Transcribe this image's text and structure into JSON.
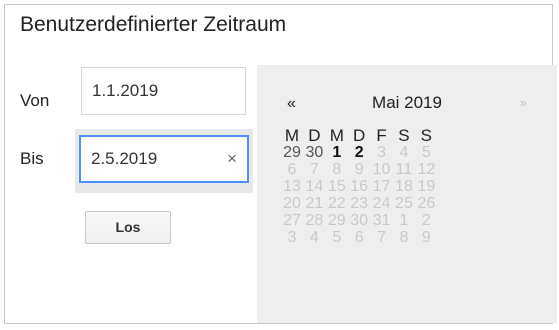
{
  "title": "Benutzerdefinierter Zeitraum",
  "from": {
    "label": "Von",
    "value": "1.1.2019"
  },
  "to": {
    "label": "Bis",
    "value": "2.5.2019",
    "clear_icon": "×"
  },
  "submit_label": "Los",
  "calendar": {
    "prev": "«",
    "next": "»",
    "month": "Mai 2019",
    "weekdays": [
      "M",
      "D",
      "M",
      "D",
      "F",
      "S",
      "S"
    ],
    "weeks": [
      [
        "29",
        "30",
        "1",
        "2",
        "3",
        "4",
        "5"
      ],
      [
        "6",
        "7",
        "8",
        "9",
        "10",
        "11",
        "12"
      ],
      [
        "13",
        "14",
        "15",
        "16",
        "17",
        "18",
        "19"
      ],
      [
        "20",
        "21",
        "22",
        "23",
        "24",
        "25",
        "26"
      ],
      [
        "27",
        "28",
        "29",
        "30",
        "31",
        "1",
        "2"
      ],
      [
        "3",
        "4",
        "5",
        "6",
        "7",
        "8",
        "9"
      ]
    ]
  }
}
